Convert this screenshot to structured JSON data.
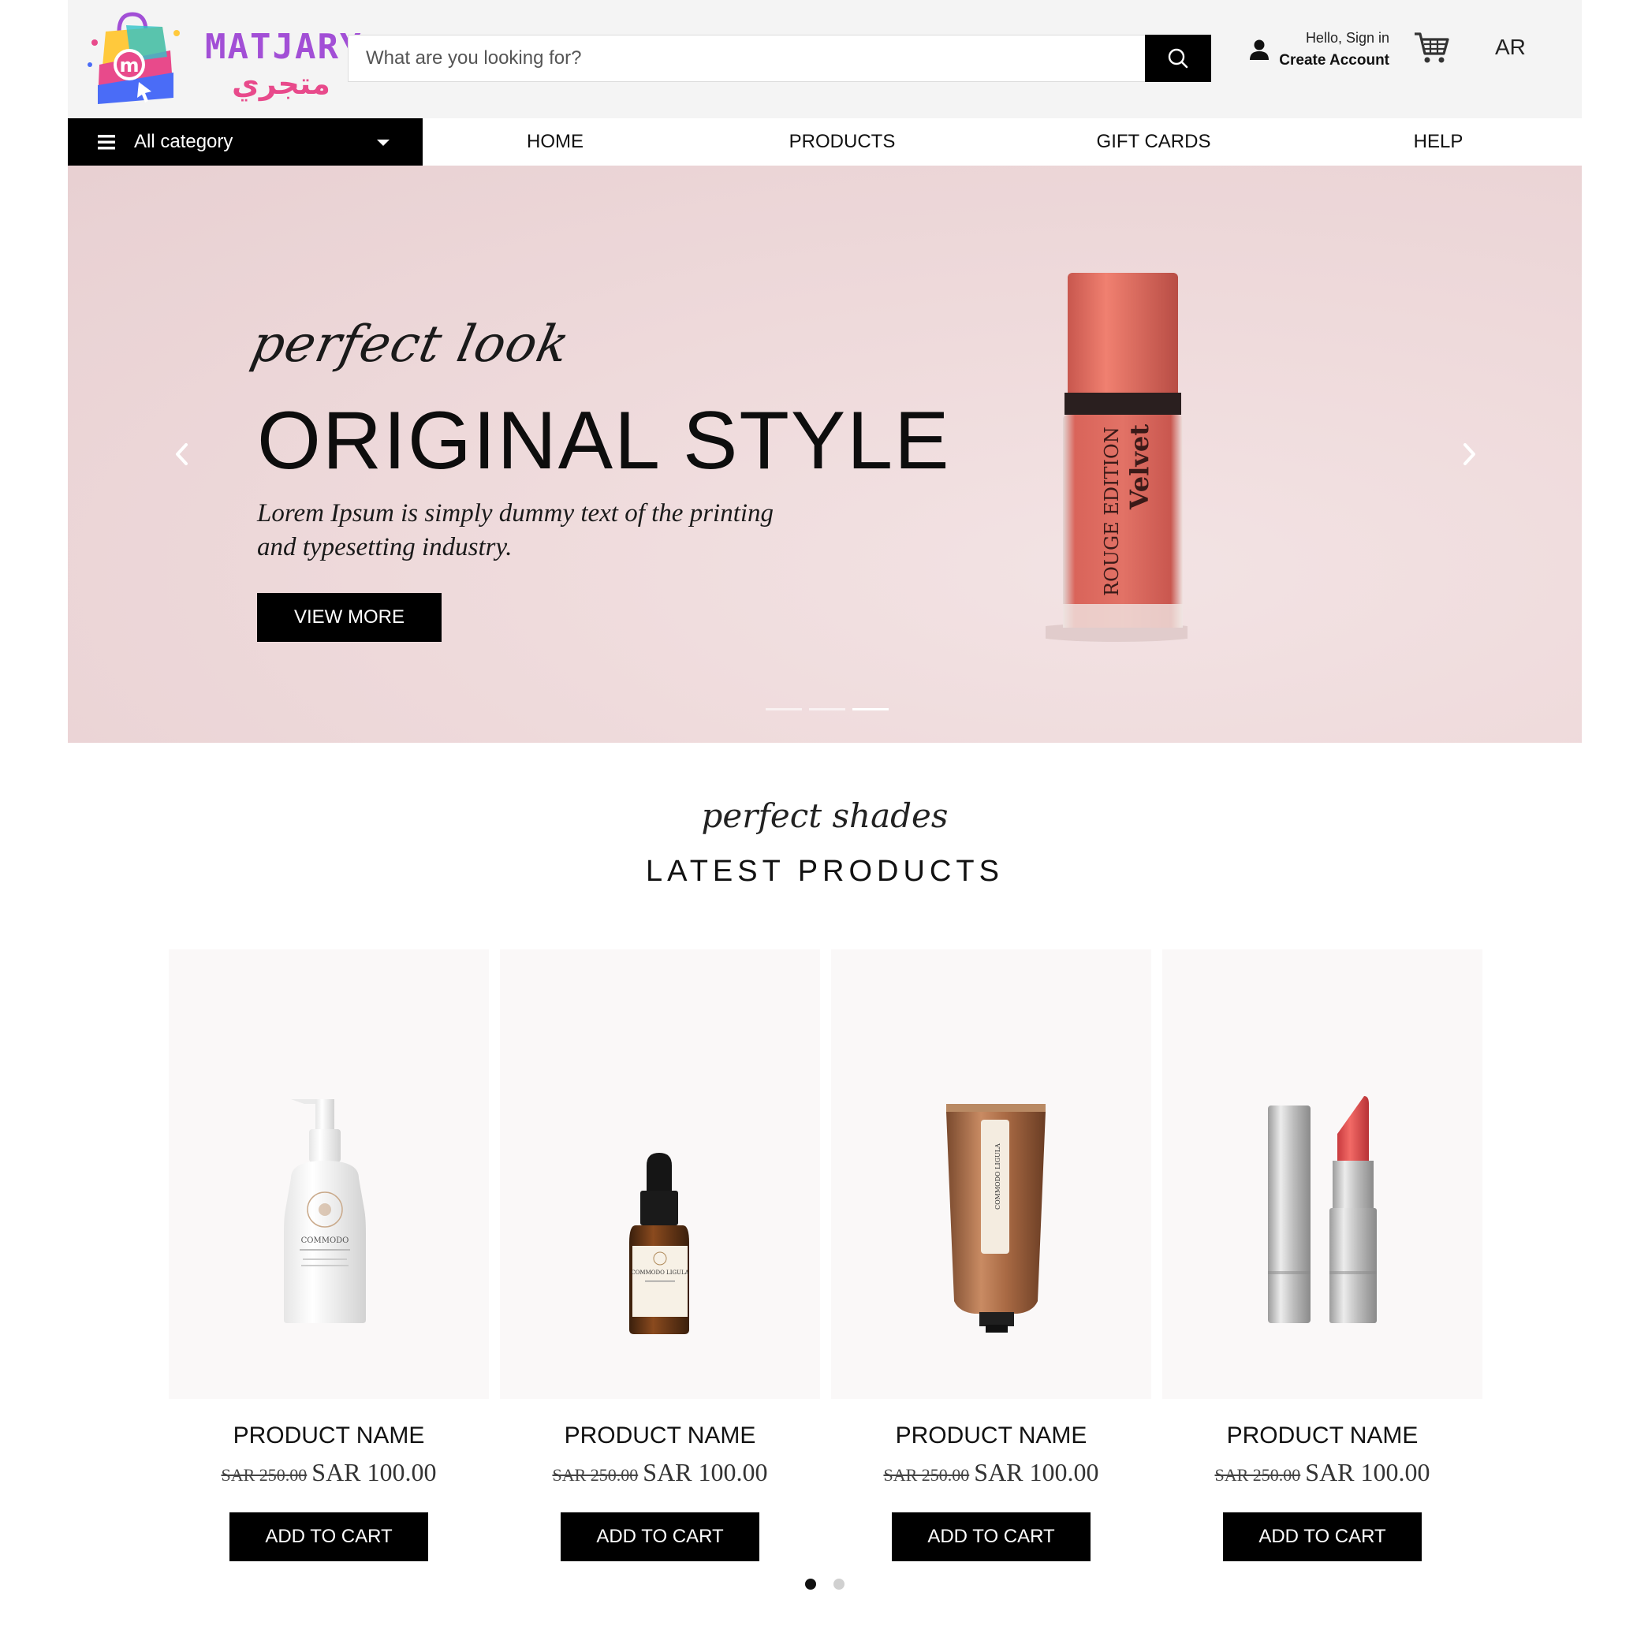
{
  "brand": {
    "name_en": "MATJARY",
    "name_ar": "متجري",
    "logo_letter": "m",
    "colors": {
      "purple": "#a24fd6",
      "pink": "#e84a8b",
      "yellow": "#ffc93c",
      "blue": "#4a6cf7"
    }
  },
  "search": {
    "placeholder": "What are you looking for?",
    "value": ""
  },
  "account": {
    "greeting": "Hello, Sign in",
    "create": "Create Account"
  },
  "language": "AR",
  "nav": {
    "all_category": "All category",
    "links": [
      "HOME",
      "PRODUCTS",
      "GIFT CARDS",
      "HELP"
    ]
  },
  "hero": {
    "tagline": "perfect look",
    "title": "ORIGINAL STYLE",
    "description": "Lorem Ipsum is simply dummy text of the printing and typesetting industry.",
    "button": "VIEW MORE",
    "product_label_1": "ROUGE EDITION",
    "product_label_2": "Velvet",
    "slides": 3,
    "active_slide": 3
  },
  "latest": {
    "tagline": "perfect shades",
    "title": "LATEST PRODUCTS",
    "products": [
      {
        "image": "pump-bottle",
        "name": "PRODUCT NAME",
        "old_price": "SAR 250.00",
        "price": "SAR 100.00",
        "button": "ADD TO CART",
        "label": "COMMODO"
      },
      {
        "image": "dropper-bottle",
        "name": "PRODUCT NAME",
        "old_price": "SAR 250.00",
        "price": "SAR 100.00",
        "button": "ADD TO CART",
        "label": "COMMODO LIGULA"
      },
      {
        "image": "cream-tube",
        "name": "PRODUCT NAME",
        "old_price": "SAR 250.00",
        "price": "SAR 100.00",
        "button": "ADD TO CART",
        "label": "COMMODO LIGULA"
      },
      {
        "image": "lipstick",
        "name": "PRODUCT NAME",
        "old_price": "SAR 250.00",
        "price": "SAR 100.00",
        "button": "ADD TO CART"
      }
    ],
    "pages": 2,
    "active_page": 1
  }
}
